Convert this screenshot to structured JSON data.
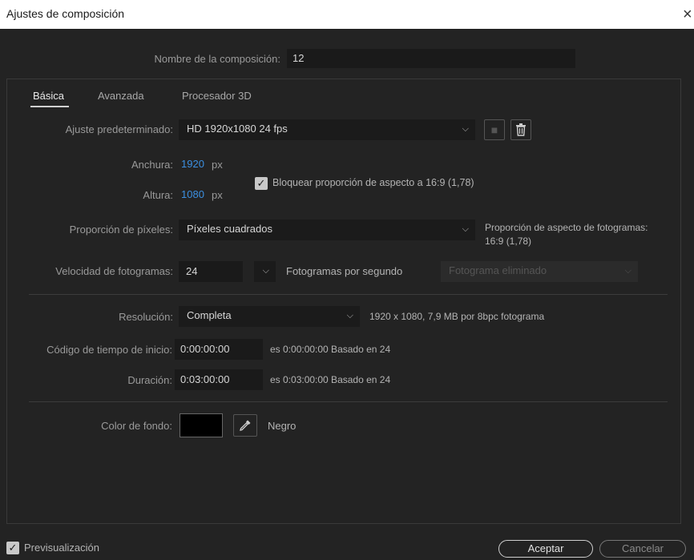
{
  "window": {
    "title": "Ajustes de composición",
    "close_glyph": "×"
  },
  "composition_name": {
    "label": "Nombre de la composición:",
    "value": "12"
  },
  "tabs": [
    {
      "label": "Básica",
      "active": true
    },
    {
      "label": "Avanzada",
      "active": false
    },
    {
      "label": "Procesador 3D",
      "active": false
    }
  ],
  "preset": {
    "label": "Ajuste predeterminado:",
    "value": "HD   1920x1080  24 fps",
    "save_icon": "save-preset-icon",
    "delete_icon": "trash-icon"
  },
  "width": {
    "label": "Anchura:",
    "value": "1920",
    "unit": "px"
  },
  "height": {
    "label": "Altura:",
    "value": "1080",
    "unit": "px"
  },
  "lock_aspect": {
    "checked": true,
    "label": "Bloquear proporción de aspecto a 16:9 (1,78)"
  },
  "pixel_aspect": {
    "label": "Proporción de píxeles:",
    "value": "Píxeles cuadrados",
    "frame_aspect_label": "Proporción de aspecto de fotogramas:",
    "frame_aspect_value": "16:9 (1,78)"
  },
  "frame_rate": {
    "label": "Velocidad de fotogramas:",
    "value": "24",
    "unit": "Fotogramas por segundo",
    "drop_frame": "Fotograma eliminado"
  },
  "resolution": {
    "label": "Resolución:",
    "value": "Completa",
    "info": "1920 x 1080, 7,9 MB por 8bpc fotograma"
  },
  "start_timecode": {
    "label": "Código de tiempo de inicio:",
    "value": "0:00:00:00",
    "info": "es 0:00:00:00  Basado en 24"
  },
  "duration": {
    "label": "Duración:",
    "value": "0:03:00:00",
    "info": "es 0:03:00:00  Basado en 24"
  },
  "background_color": {
    "label": "Color de fondo:",
    "swatch": "#000000",
    "name": "Negro",
    "eyedropper_icon": "eyedropper-icon"
  },
  "preview": {
    "checked": true,
    "label": "Previsualización"
  },
  "buttons": {
    "ok": "Aceptar",
    "cancel": "Cancelar"
  },
  "colors": {
    "accent_blue": "#3b8fe0",
    "background": "#232323",
    "field": "#1a1a1a"
  }
}
